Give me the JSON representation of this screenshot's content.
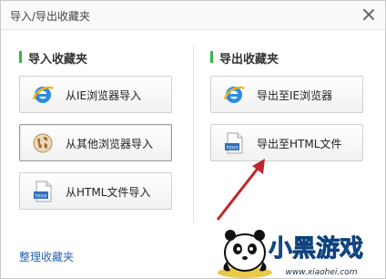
{
  "dialog": {
    "title": "导入/导出收藏夹"
  },
  "import_section": {
    "title": "导入收藏夹",
    "buttons": [
      {
        "label": "从IE浏览器导入",
        "icon": "ie-icon"
      },
      {
        "label": "从其他浏览器导入",
        "icon": "globe-icon"
      },
      {
        "label": "从HTML文件导入",
        "icon": "html-file-icon"
      }
    ]
  },
  "export_section": {
    "title": "导出收藏夹",
    "buttons": [
      {
        "label": "导出至IE浏览器",
        "icon": "ie-icon"
      },
      {
        "label": "导出至HTML文件",
        "icon": "html-file-icon"
      }
    ]
  },
  "footer": {
    "organize_link": "整理收藏夹"
  },
  "watermark": {
    "brand": "小黑游戏",
    "url": "www.xiaohei.com"
  },
  "colors": {
    "accent": "#38b54a",
    "link": "#2a62b0",
    "arrow": "#c0272d"
  }
}
